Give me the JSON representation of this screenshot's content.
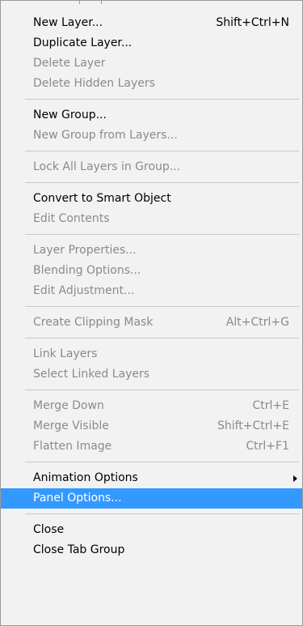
{
  "menu": {
    "groups": [
      {
        "items": [
          {
            "label": "New Layer...",
            "shortcut": "Shift+Ctrl+N",
            "enabled": true
          },
          {
            "label": "Duplicate Layer...",
            "shortcut": "",
            "enabled": true
          },
          {
            "label": "Delete Layer",
            "shortcut": "",
            "enabled": false
          },
          {
            "label": "Delete Hidden Layers",
            "shortcut": "",
            "enabled": false
          }
        ]
      },
      {
        "items": [
          {
            "label": "New Group...",
            "shortcut": "",
            "enabled": true
          },
          {
            "label": "New Group from Layers...",
            "shortcut": "",
            "enabled": false
          }
        ]
      },
      {
        "items": [
          {
            "label": "Lock All Layers in Group...",
            "shortcut": "",
            "enabled": false
          }
        ]
      },
      {
        "items": [
          {
            "label": "Convert to Smart Object",
            "shortcut": "",
            "enabled": true
          },
          {
            "label": "Edit Contents",
            "shortcut": "",
            "enabled": false
          }
        ]
      },
      {
        "items": [
          {
            "label": "Layer Properties...",
            "shortcut": "",
            "enabled": false
          },
          {
            "label": "Blending Options...",
            "shortcut": "",
            "enabled": false
          },
          {
            "label": "Edit Adjustment...",
            "shortcut": "",
            "enabled": false
          }
        ]
      },
      {
        "items": [
          {
            "label": "Create Clipping Mask",
            "shortcut": "Alt+Ctrl+G",
            "enabled": false
          }
        ]
      },
      {
        "items": [
          {
            "label": "Link Layers",
            "shortcut": "",
            "enabled": false
          },
          {
            "label": "Select Linked Layers",
            "shortcut": "",
            "enabled": false
          }
        ]
      },
      {
        "items": [
          {
            "label": "Merge Down",
            "shortcut": "Ctrl+E",
            "enabled": false
          },
          {
            "label": "Merge Visible",
            "shortcut": "Shift+Ctrl+E",
            "enabled": false
          },
          {
            "label": "Flatten Image",
            "shortcut": "Ctrl+F1",
            "enabled": false
          }
        ]
      },
      {
        "items": [
          {
            "label": "Animation Options",
            "shortcut": "",
            "enabled": true,
            "submenu": true,
            "submenu_icon": "triangle-right-icon"
          },
          {
            "label": "Panel Options...",
            "shortcut": "",
            "enabled": true,
            "highlighted": true
          }
        ]
      },
      {
        "items": [
          {
            "label": "Close",
            "shortcut": "",
            "enabled": true
          },
          {
            "label": "Close Tab Group",
            "shortcut": "",
            "enabled": true
          }
        ]
      }
    ]
  },
  "colors": {
    "menu_background": "#f2f2f2",
    "enabled_text": "#000000",
    "disabled_text": "#8a8a8a",
    "highlight_background": "#3399ff",
    "highlight_text": "#ffffff",
    "separator": "#c8c8c8"
  }
}
